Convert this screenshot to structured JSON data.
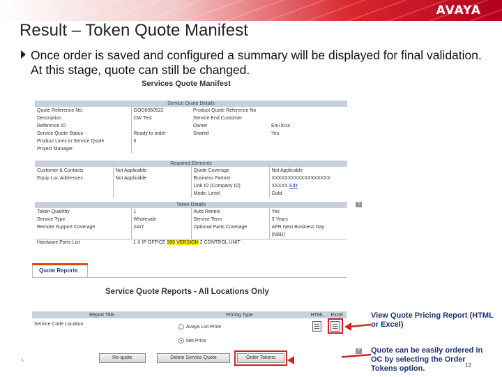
{
  "header": {
    "brand": "AVAYA"
  },
  "slide": {
    "title": "Result – Token Quote Manifest",
    "bullet": "Once order is saved and configured a summary will be displayed for final validation. At this stage, quote can still be changed.",
    "page_number": "12",
    "footer_mark": "A"
  },
  "manifest": {
    "title": "Services Quote Manifest",
    "service_quote_details": {
      "header": "Service Quote Details",
      "rows": [
        [
          "Quote Reference No.",
          "GOD0050522",
          "Product Quote Reference No",
          ""
        ],
        [
          "Description",
          "CW Test",
          "Service End Customer",
          ""
        ],
        [
          "Reference ID",
          "",
          "Owner",
          "Emi Kiss"
        ],
        [
          "Service Quote Status",
          "Ready to order",
          "Shared",
          "Yes"
        ],
        [
          "Product Lines in Service Quote",
          "0",
          "",
          ""
        ],
        [
          "Project Manager",
          "",
          "",
          ""
        ]
      ]
    },
    "required_elements": {
      "header": "Required Elements",
      "rows": [
        [
          "Customer & Contacts",
          "Not Applicable",
          "Quote Coverage",
          "Not Applicable"
        ],
        [
          "Equip Loc Addresses",
          "Not Applicable",
          "Business Partner",
          "XXXXXXXXXXXXXXXXXX"
        ],
        [
          "",
          "",
          "Link ID (Company ID)",
          "XXXXX"
        ],
        [
          "",
          "",
          "Mode, Level",
          "Gold"
        ]
      ],
      "edit_link": "Edit"
    },
    "token_details": {
      "header": "Token Details",
      "rows": [
        [
          "Token Quantity",
          "1",
          "Auto Renew",
          "Yes"
        ],
        [
          "Service Type",
          "Wholesale",
          "Service Term",
          "3 Years"
        ],
        [
          "Remote Support Coverage",
          "24x7",
          "Optional Parts Coverage",
          "APR Next Business Day"
        ],
        [
          "",
          "",
          "",
          "(NBD)"
        ]
      ],
      "hardware_label": "Hardware Parts List",
      "hardware_value": {
        "pre": "1 X IP OFFICE ",
        "hl1": "500",
        "mid": " ",
        "hl2": "VERSION",
        "post": " 2 CONTROL UNIT"
      }
    },
    "help_glyph": "?"
  },
  "reports": {
    "tab_label": "Quote Reports",
    "title": "Service Quote Reports - All Locations Only",
    "headers": {
      "report_title": "Report Title",
      "pricing_type": "Pricing Type",
      "html": "HTML",
      "excel": "Excel"
    },
    "row": {
      "report": "Service Code Location"
    },
    "pricing_options": [
      {
        "label": "Avaya List Price",
        "selected": false
      },
      {
        "label": "Net Price",
        "selected": true
      }
    ]
  },
  "buttons": {
    "requote": "Re-quote",
    "delete": "Delete Service Quote",
    "order_tokens": "Order Tokens"
  },
  "callouts": {
    "pricing_report": "View Quote Pricing Report (HTML or Excel)",
    "order": "Quote can be easily ordered in OC by selecting the Order Tokens option."
  },
  "colors": {
    "callout_text": "#1f2f6f",
    "highlight_box": "#d42020",
    "brand_band": "#d9262e"
  }
}
